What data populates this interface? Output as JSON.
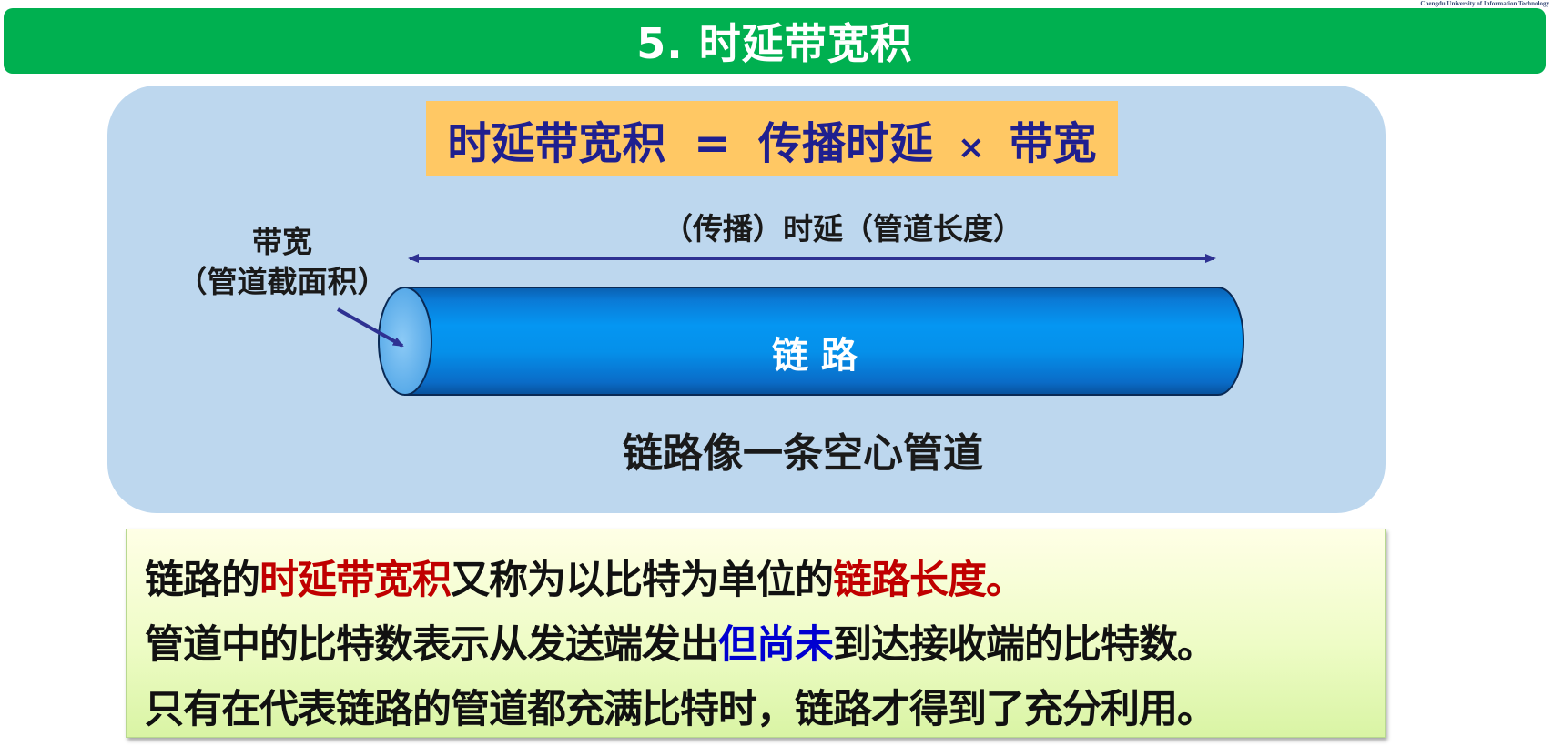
{
  "watermark": "Chengdu University of Information Technology",
  "title": "5. 时延带宽积",
  "formula": {
    "lhs": "时延带宽积",
    "equals": "=",
    "term1": "传播时延",
    "times": "×",
    "term2": "带宽"
  },
  "diagram": {
    "delay_label": "（传播）时延（管道长度）",
    "bandwidth_label_line1": "带宽",
    "bandwidth_label_line2": "（管道截面积）",
    "pipe_label": "链 路",
    "caption": "链路像一条空心管道",
    "colors": {
      "panel": "#bdd7ee",
      "pipe_body": "#0090e8",
      "pipe_end": "#6ab8f0",
      "arrow": "#2e3192"
    }
  },
  "notes": {
    "line1": {
      "part1": "链路的",
      "part2": "时延带宽积",
      "part3": "又称为以比特为单位的",
      "part4": "链路长度。"
    },
    "line2": {
      "part1": "管道中的比特数表示从发送端发出",
      "part2": "但尚未",
      "part3": "到达接收端的比特数。"
    },
    "line3": "只有在代表链路的管道都充满比特时，链路才得到了充分利用。"
  }
}
